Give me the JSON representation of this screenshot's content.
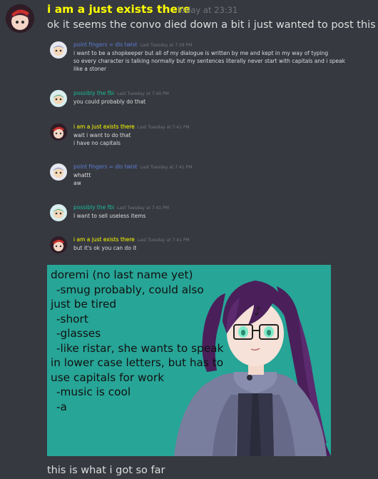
{
  "message": {
    "username": "i am a just exists there",
    "timestamp": "Today at 23:31",
    "text": "ok it seems the convo died down a bit i just wanted to post this",
    "caption": "this is what i got so far"
  },
  "screenshot_messages": [
    {
      "author": "point fingers = dis twist",
      "author_color": "#5d7dd6",
      "time": "Last Tuesday at 7:39 PM",
      "lines": [
        "i want to be a shopkeeper but all of my dialogue is written by me and kept in my way of typing",
        "so every character is talking normally but my sentences literally never start with capitals and i speak",
        "like a stoner"
      ]
    },
    {
      "author": "possibly the fbi",
      "author_color": "#1abc9c",
      "time": "Last Tuesday at 7:40 PM",
      "lines": [
        "you could probably do that"
      ]
    },
    {
      "author": "i am a just exists there",
      "author_color": "#ffff00",
      "time": "Last Tuesday at 7:41 PM",
      "lines": [
        "wait i want to do that",
        "i have no capitals"
      ]
    },
    {
      "author": "point fingers = dis twist",
      "author_color": "#5d7dd6",
      "time": "Last Tuesday at 7:41 PM",
      "lines": [
        "whattt",
        "aw"
      ]
    },
    {
      "author": "possibly the fbi",
      "author_color": "#1abc9c",
      "time": "Last Tuesday at 7:41 PM",
      "lines": [
        "I want to sell useless items"
      ]
    },
    {
      "author": "i am a just exists there",
      "author_color": "#ffff00",
      "time": "Last Tuesday at 7:41 PM",
      "lines": [
        "but it's ok you can do it"
      ]
    }
  ],
  "character_sheet": {
    "background_color": "#27a597",
    "lines": [
      "doremi (no last name yet)",
      "  -smug probably, could also",
      "just be tired",
      "  -short",
      "  -glasses",
      "  -like ristar, she wants to speak",
      "in lower case letters, but has to",
      "use capitals for work",
      "  -music is cool",
      "  -a"
    ]
  },
  "colors": {
    "background": "#36393f",
    "text": "#dcddde",
    "timestamp": "#72767d",
    "main_username": "#ffff00"
  }
}
